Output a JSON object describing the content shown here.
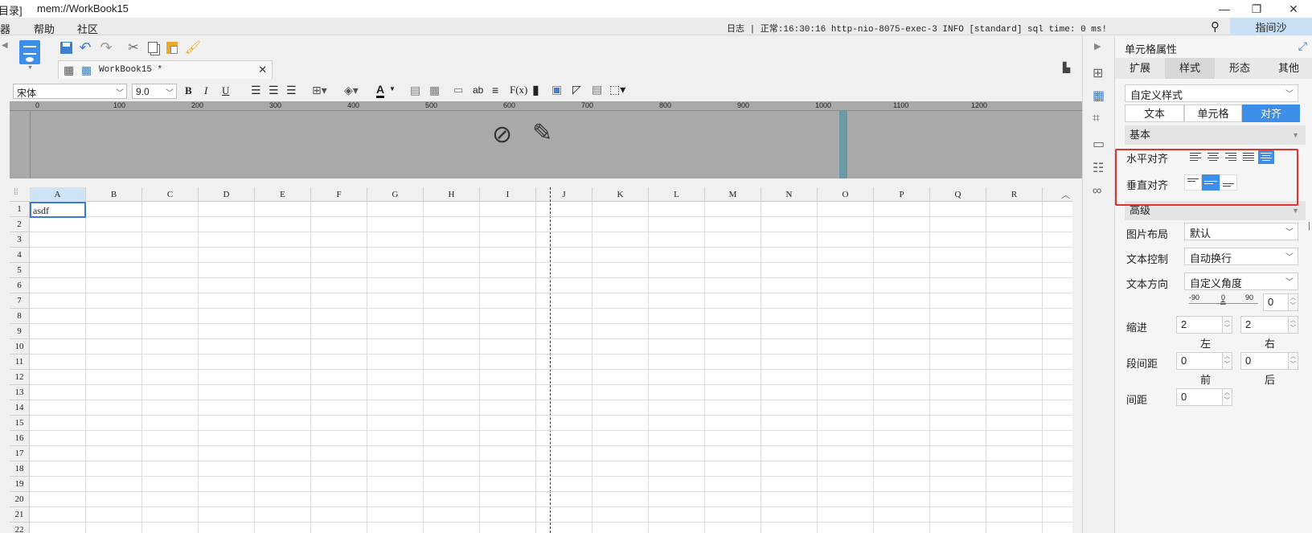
{
  "titlebar": {
    "left_fragment": "目录]",
    "title": "mem://WorkBook15"
  },
  "menubar": {
    "items": [
      "器",
      "帮助",
      "社区"
    ],
    "log": "日志 | 正常:16:30:16 http-nio-8075-exec-3 INFO [standard] sql time: 0 ms!",
    "user": "指间沙"
  },
  "tab": {
    "label": "WorkBook15 *"
  },
  "format": {
    "font": "宋体",
    "size": "9.0"
  },
  "ruler": {
    "ticks": [
      "0",
      "100",
      "200",
      "300",
      "400",
      "500",
      "600",
      "700",
      "800",
      "900",
      "1000",
      "1100",
      "1200"
    ]
  },
  "grid": {
    "columns": [
      "A",
      "B",
      "C",
      "D",
      "E",
      "F",
      "G",
      "H",
      "I",
      "J",
      "K",
      "L",
      "M",
      "N",
      "O",
      "P",
      "Q",
      "R"
    ],
    "rows": [
      "1",
      "2",
      "3",
      "4",
      "5",
      "6",
      "7",
      "8",
      "9",
      "10",
      "11",
      "12",
      "13",
      "14",
      "15",
      "16",
      "17",
      "18",
      "19",
      "20",
      "21",
      "22"
    ],
    "a1": "asdf"
  },
  "panel": {
    "title": "单元格属性",
    "tabs": [
      "扩展",
      "样式",
      "形态",
      "其他"
    ],
    "style_select": "自定义样式",
    "seg": [
      "文本",
      "单元格",
      "对齐"
    ],
    "basic": "基本",
    "h_align": "水平对齐",
    "v_align": "垂直对齐",
    "advanced": "高级",
    "img_layout_label": "图片布局",
    "img_layout_value": "默认",
    "text_ctrl_label": "文本控制",
    "text_ctrl_value": "自动换行",
    "text_dir_label": "文本方向",
    "text_dir_value": "自定义角度",
    "angle_min": "-90",
    "angle_mid": "0",
    "angle_max": "90",
    "angle_value": "0",
    "indent_label": "缩进",
    "indent_left": "2",
    "indent_right": "2",
    "left": "左",
    "right": "右",
    "para_label": "段间距",
    "para_before": "0",
    "para_after": "0",
    "before": "前",
    "after": "后",
    "spacing_label": "间距",
    "spacing_value": "0"
  }
}
